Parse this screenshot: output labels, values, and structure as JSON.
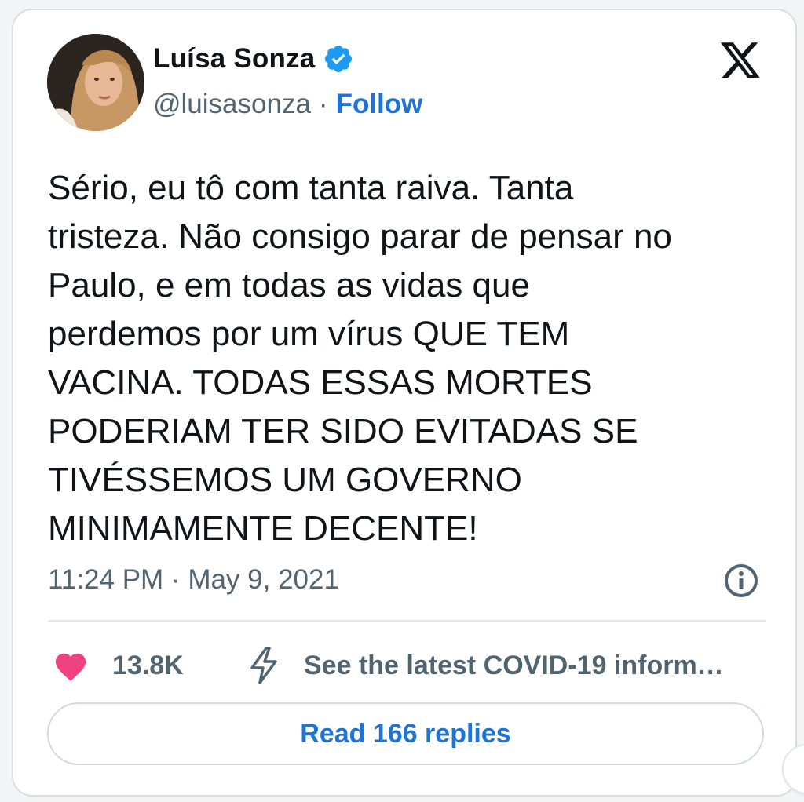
{
  "author": {
    "display_name": "Luísa Sonza",
    "handle": "@luisasonza",
    "separator": "·",
    "follow_label": "Follow",
    "verified_color": "#1d9bf0"
  },
  "tweet": {
    "text": "Sério, eu tô com tanta raiva. Tanta\ntristeza. Não consigo parar de pensar no\nPaulo, e em todas as vidas que\nperdemos por um vírus QUE TEM\nVACINA. TODAS ESSAS MORTES\nPODERIAM TER SIDO EVITADAS SE\nTIVÉSSEMOS UM GOVERNO\nMINIMAMENTE DECENTE!",
    "timestamp": "11:24 PM · May 9, 2021"
  },
  "actions": {
    "like_count": "13.8K",
    "covid_info_label": "See the latest COVID-19 inform…",
    "like_color": "#f0427f"
  },
  "replies": {
    "button_label": "Read 166 replies"
  },
  "icons": {
    "platform": "x-logo-icon",
    "info": "info-icon",
    "like": "heart-icon",
    "covid": "lightning-icon",
    "verified": "verified-badge-icon"
  },
  "colors": {
    "accent": "#1d74d6",
    "text_primary": "#0f1419",
    "text_secondary": "#536471",
    "border": "#cfd9de"
  }
}
